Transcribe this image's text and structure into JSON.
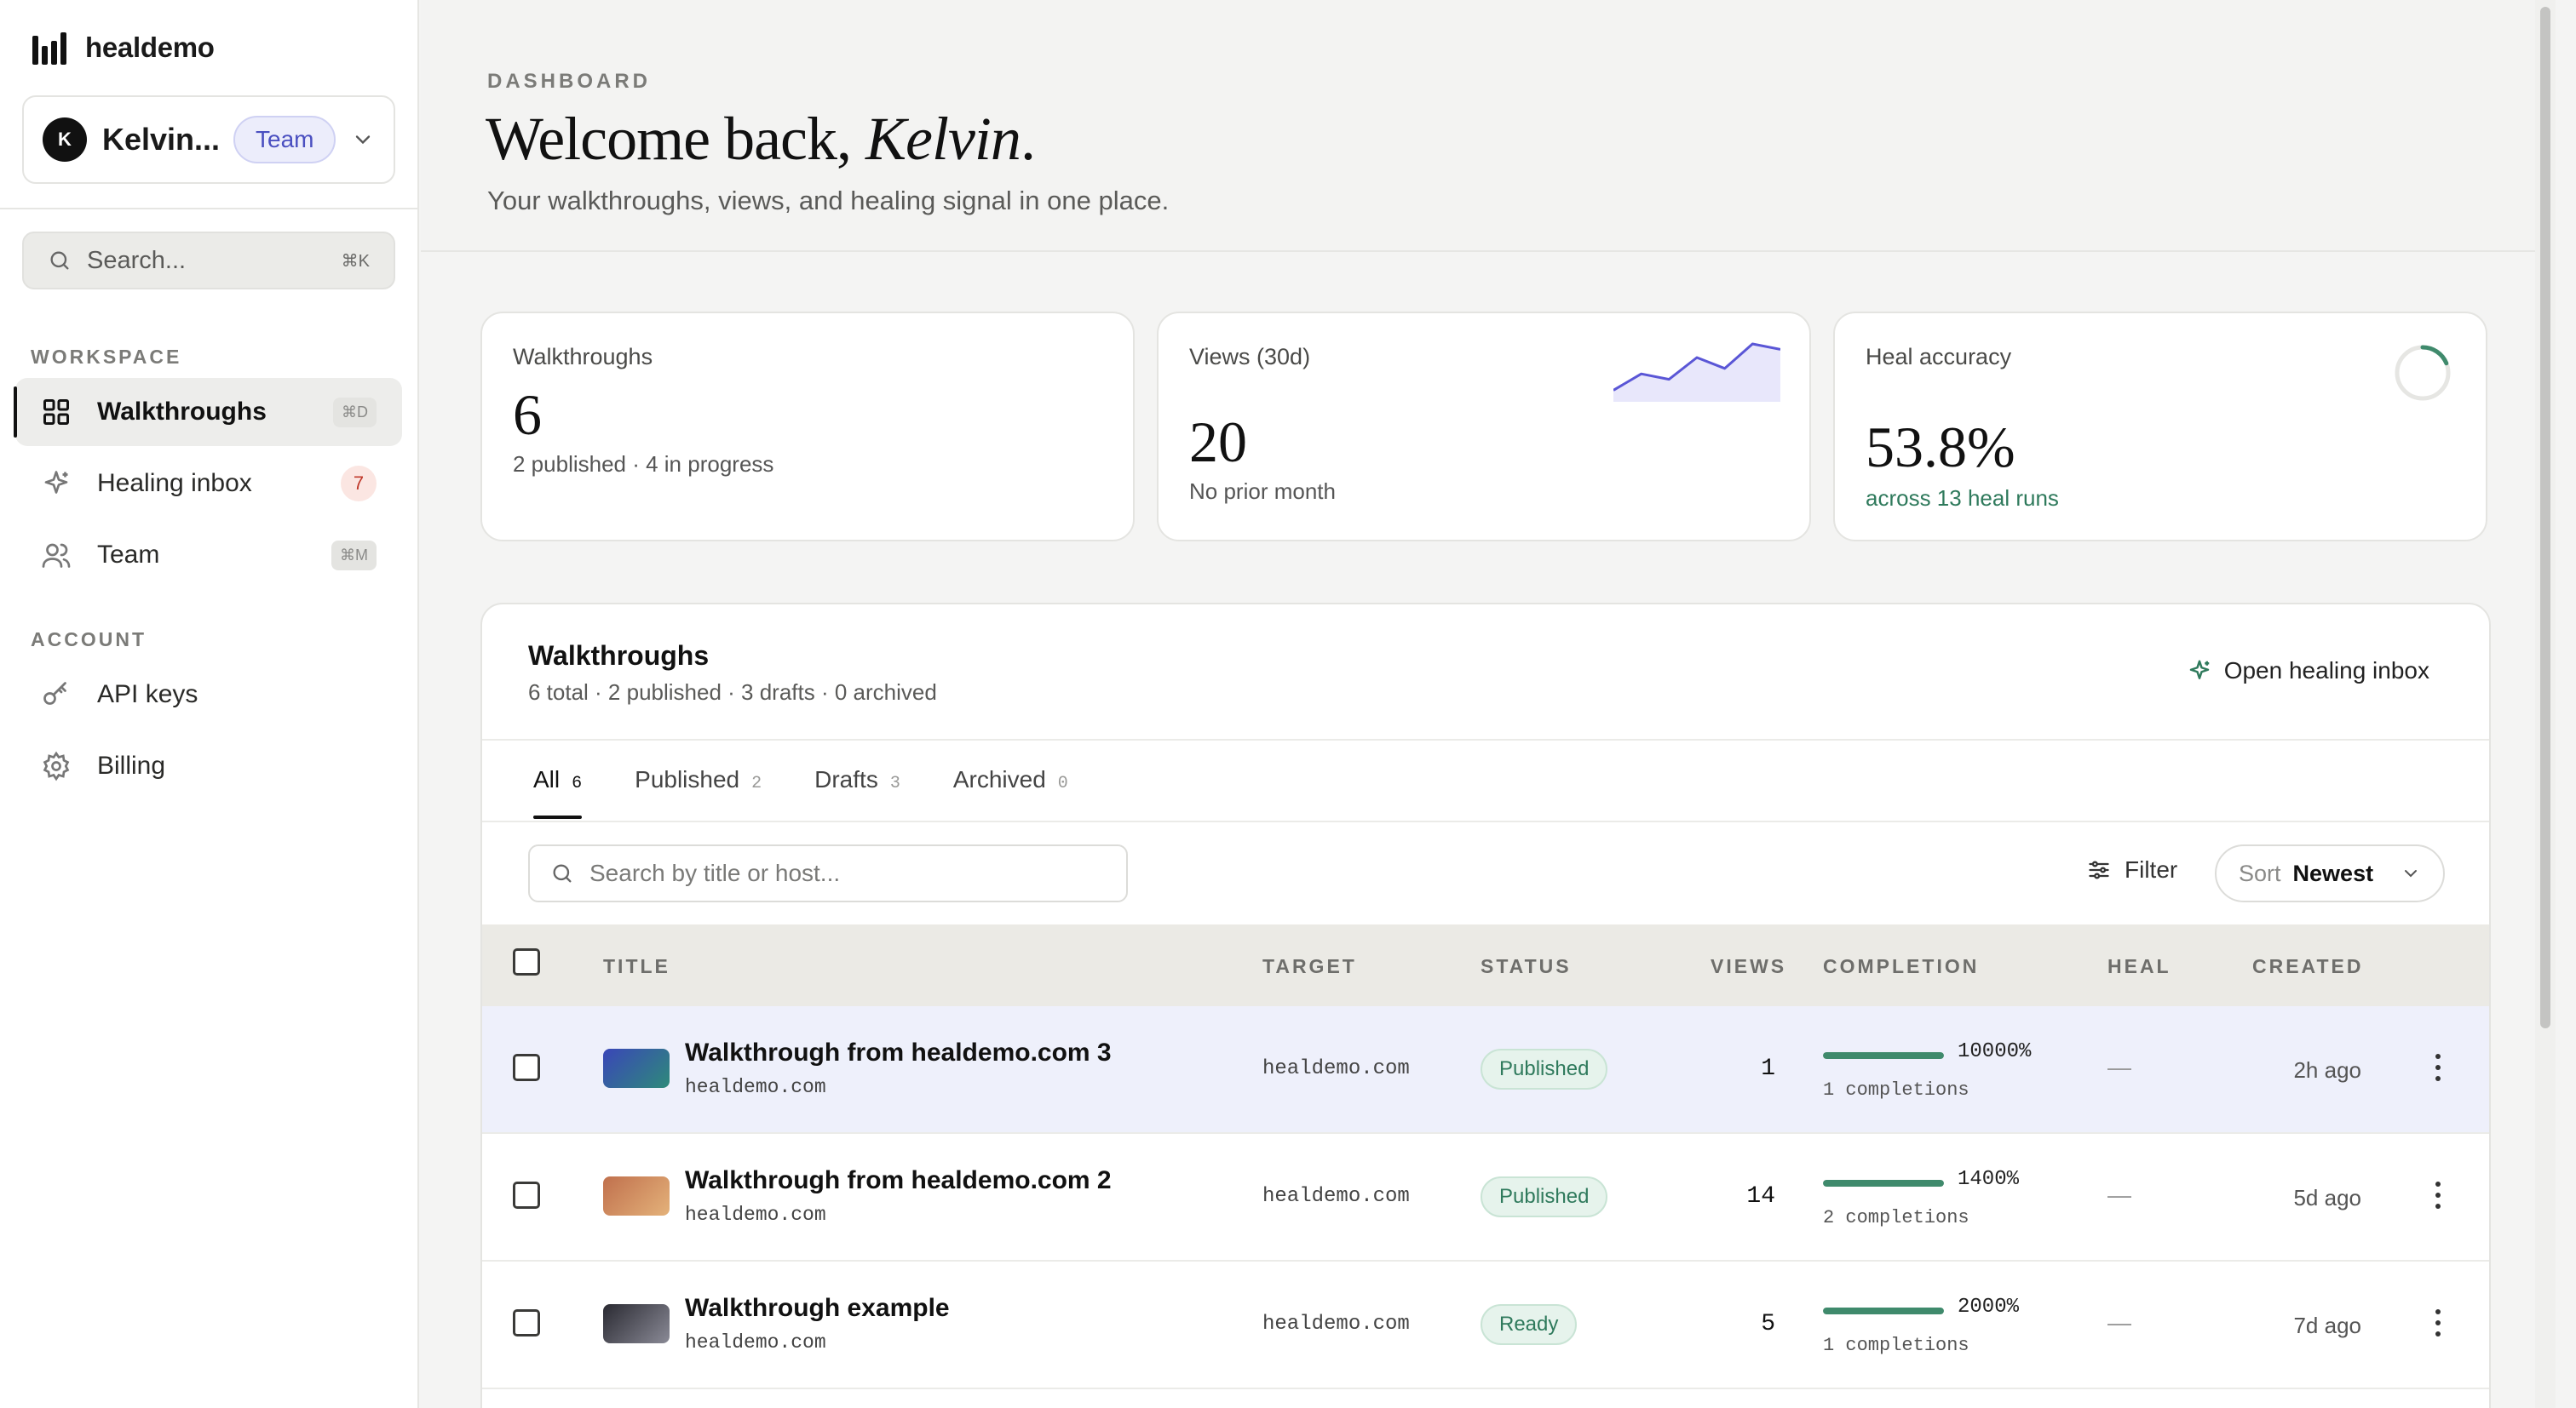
{
  "brand": {
    "name": "healdemo"
  },
  "team_switcher": {
    "avatar_initial": "K",
    "user": "Kelvin...",
    "badge": "Team"
  },
  "search": {
    "label": "Search...",
    "shortcut": "⌘K"
  },
  "sidebar": {
    "workspace_label": "WORKSPACE",
    "account_label": "ACCOUNT",
    "items": [
      {
        "label": "Walkthroughs",
        "shortcut": "⌘D",
        "icon": "grid-icon"
      },
      {
        "label": "Healing inbox",
        "count": "7",
        "icon": "sparkle-icon"
      },
      {
        "label": "Team",
        "shortcut": "⌘M",
        "icon": "users-icon"
      },
      {
        "label": "API keys",
        "icon": "key-icon"
      },
      {
        "label": "Billing",
        "icon": "gear-icon"
      }
    ]
  },
  "header": {
    "eyebrow": "DASHBOARD",
    "welcome_prefix": "Welcome back,",
    "welcome_name": "Kelvin",
    "welcome_suffix": ".",
    "subtitle": "Your walkthroughs, views, and healing signal in one place."
  },
  "stats": [
    {
      "title": "Walkthroughs",
      "value": "6",
      "sub": "2 published · 4 in progress"
    },
    {
      "title": "Views (30d)",
      "value": "20",
      "sub": "No prior month",
      "sparkline": [
        0.15,
        0.45,
        0.35,
        0.75,
        0.55,
        1.0,
        0.9
      ]
    },
    {
      "title": "Heal accuracy",
      "value": "53.8%",
      "sub": "across 13 heal runs",
      "ring_progress": 0.538
    }
  ],
  "table_card": {
    "title": "Walkthroughs",
    "subtitle": "6 total · 2 published · 3 drafts · 0 archived",
    "open_inbox": "Open healing inbox",
    "tabs": [
      {
        "label": "All",
        "count": "6"
      },
      {
        "label": "Published",
        "count": "2"
      },
      {
        "label": "Drafts",
        "count": "3"
      },
      {
        "label": "Archived",
        "count": "0"
      }
    ],
    "search_placeholder": "Search by title or host...",
    "filter_label": "Filter",
    "sort_label": "Sort",
    "sort_value": "Newest",
    "columns": [
      "TITLE",
      "TARGET",
      "STATUS",
      "VIEWS",
      "COMPLETION",
      "HEAL",
      "CREATED"
    ],
    "rows": [
      {
        "title": "Walkthrough from healdemo.com 3",
        "host": "healdemo.com",
        "target": "healdemo.com",
        "status": "Published",
        "views": "1",
        "completion_pct": "10000%",
        "completion_fill": 1.0,
        "completions": "1 completions",
        "heal": "—",
        "created": "2h ago",
        "thumb_from": "#3a46b8",
        "thumb_to": "#2e8a7a"
      },
      {
        "title": "Walkthrough from healdemo.com 2",
        "host": "healdemo.com",
        "target": "healdemo.com",
        "status": "Published",
        "views": "14",
        "completion_pct": "1400%",
        "completion_fill": 1.0,
        "completions": "2 completions",
        "heal": "—",
        "created": "5d ago",
        "thumb_from": "#c0704d",
        "thumb_to": "#e4b27a"
      },
      {
        "title": "Walkthrough example",
        "host": "healdemo.com",
        "target": "healdemo.com",
        "status": "Ready",
        "views": "5",
        "completion_pct": "2000%",
        "completion_fill": 1.0,
        "completions": "1 completions",
        "heal": "—",
        "created": "7d ago",
        "thumb_from": "#2a2a32",
        "thumb_to": "#8a8a96"
      }
    ]
  },
  "colors": {
    "accent": "#4a4fc0",
    "success": "#2f7a5c",
    "sparkline": "#5a56d6"
  }
}
